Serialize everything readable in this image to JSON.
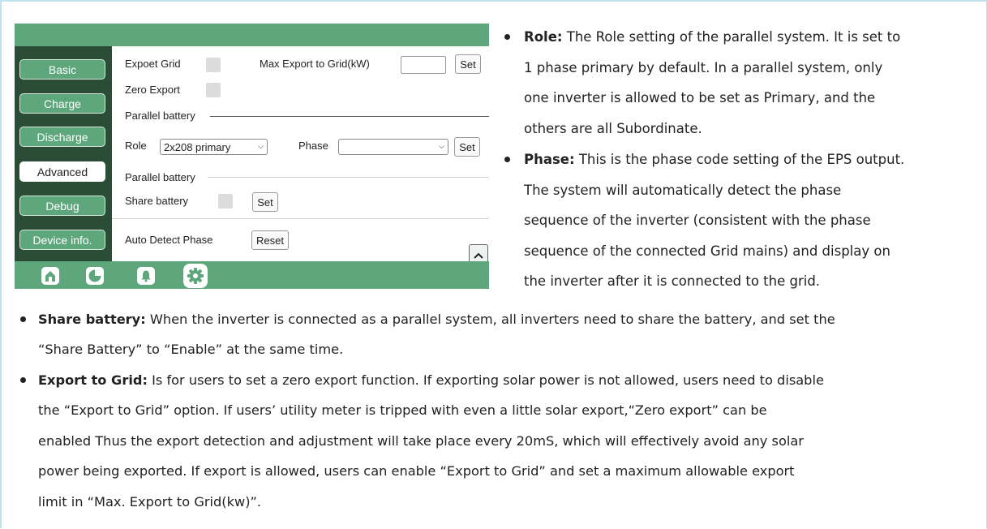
{
  "device": {
    "sidebar": [
      "Basic",
      "Charge",
      "Discharge",
      "Advanced",
      "Debug",
      "Device info."
    ],
    "active_tab": "Advanced",
    "nav_icons": [
      "home-icon",
      "pie-chart-icon",
      "bell-icon",
      "gear-icon"
    ],
    "active_nav": "gear-icon",
    "expoet_grid_label": "Expoet Grid",
    "max_export_label": "Max Export to Grid(kW)",
    "max_export_value": "",
    "set_label": "Set",
    "zero_export_label": "Zero Export",
    "parallel_battery_label": "Parallel battery",
    "role_label": "Role",
    "role_value": "2x208 primary",
    "phase_label": "Phase",
    "phase_value": "",
    "parallel_battery_label2": "Parallel battery",
    "share_battery_label": "Share battery",
    "auto_detect_label": "Auto Detect Phase",
    "reset_label": "Reset"
  },
  "text": {
    "role": {
      "term": "Role:",
      "lines": [
        " The Role setting of the parallel system. It is set to",
        "1 phase primary by default. In a parallel system, only",
        "one inverter is allowed to be set as Primary, and the",
        "others are all Subordinate."
      ]
    },
    "phase": {
      "term": "Phase:",
      "lines": [
        " This is the phase code setting of the EPS output.",
        "The system will automatically detect the phase",
        "sequence of the inverter (consistent with the phase",
        "sequence of the connected Grid mains) and display on",
        "the inverter after it is connected to the grid."
      ]
    },
    "share": {
      "term": "Share battery:",
      "lines": [
        " When the inverter is connected as a parallel system, all inverters need to share the battery, and set the",
        "“Share Battery” to “Enable” at the same time."
      ]
    },
    "export": {
      "term": "Export to Grid:",
      "lines": [
        " Is for users to set a zero export function. If exporting solar power is not allowed, users need to disable",
        "the “Export to Grid” option. If users’ utility meter is tripped with even a little solar export,“Zero export” can be",
        "enabled Thus the export detection and adjustment will take place every 20mS, which will effectively avoid any solar",
        "power being exported. If export is allowed, users can enable “Export to Grid” and set a maximum allowable export",
        "limit in “Max. Export to Grid(kw)”."
      ]
    }
  }
}
